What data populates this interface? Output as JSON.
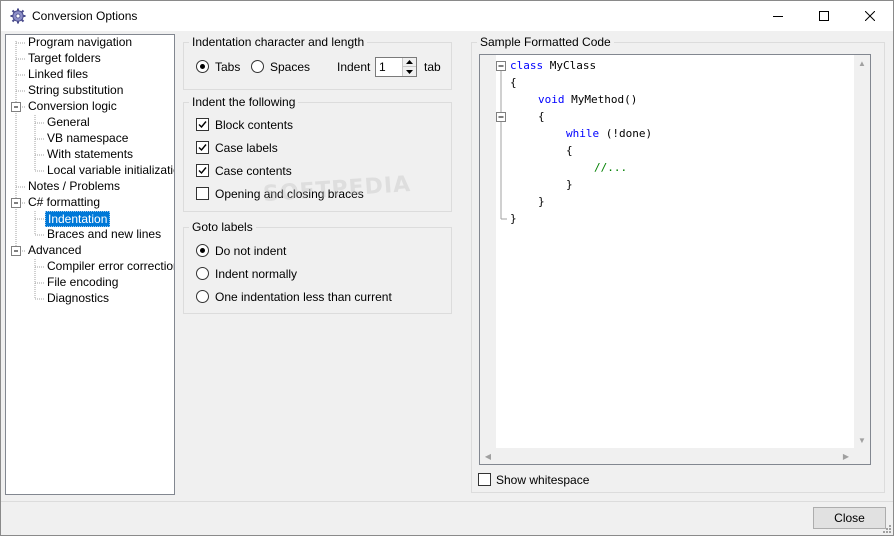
{
  "window": {
    "title": "Conversion Options",
    "icon": "gear-icon"
  },
  "tree": {
    "items": [
      {
        "label": "Program navigation",
        "level": 0,
        "expander": ""
      },
      {
        "label": "Target folders",
        "level": 0,
        "expander": ""
      },
      {
        "label": "Linked files",
        "level": 0,
        "expander": ""
      },
      {
        "label": "String substitution",
        "level": 0,
        "expander": ""
      },
      {
        "label": "Conversion logic",
        "level": 0,
        "expander": "minus"
      },
      {
        "label": "General",
        "level": 1,
        "expander": ""
      },
      {
        "label": "VB namespace",
        "level": 1,
        "expander": ""
      },
      {
        "label": "With statements",
        "level": 1,
        "expander": ""
      },
      {
        "label": "Local variable initialization",
        "level": 1,
        "expander": ""
      },
      {
        "label": "Notes / Problems",
        "level": 0,
        "expander": ""
      },
      {
        "label": "C# formatting",
        "level": 0,
        "expander": "minus"
      },
      {
        "label": "Indentation",
        "level": 1,
        "expander": "",
        "selected": true
      },
      {
        "label": "Braces and new lines",
        "level": 1,
        "expander": ""
      },
      {
        "label": "Advanced",
        "level": 0,
        "expander": "minus"
      },
      {
        "label": "Compiler error correction",
        "level": 1,
        "expander": ""
      },
      {
        "label": "File encoding",
        "level": 1,
        "expander": ""
      },
      {
        "label": "Diagnostics",
        "level": 1,
        "expander": ""
      }
    ]
  },
  "indentation_group": {
    "title": "Indentation character and length",
    "tabs_label": "Tabs",
    "spaces_label": "Spaces",
    "selected": "Tabs",
    "indent_label": "Indent",
    "indent_value": "1",
    "unit_label": "tab"
  },
  "indent_following_group": {
    "title": "Indent the following",
    "options": [
      {
        "label": "Block contents",
        "checked": true
      },
      {
        "label": "Case labels",
        "checked": true
      },
      {
        "label": "Case contents",
        "checked": true
      },
      {
        "label": "Opening and closing braces",
        "checked": false
      }
    ]
  },
  "goto_group": {
    "title": "Goto labels",
    "options": [
      {
        "label": "Do not indent",
        "selected": true
      },
      {
        "label": "Indent normally",
        "selected": false
      },
      {
        "label": "One indentation less than current",
        "selected": false
      }
    ]
  },
  "sample": {
    "title": "Sample Formatted Code",
    "lines": [
      {
        "tokens": [
          {
            "t": "class ",
            "k": "kw"
          },
          {
            "t": "MyClass",
            "k": ""
          }
        ],
        "indent": 0
      },
      {
        "tokens": [
          {
            "t": "{",
            "k": ""
          }
        ],
        "indent": 0
      },
      {
        "tokens": [
          {
            "t": "void ",
            "k": "kw"
          },
          {
            "t": "MyMethod()",
            "k": ""
          }
        ],
        "indent": 1
      },
      {
        "tokens": [
          {
            "t": "{",
            "k": ""
          }
        ],
        "indent": 1
      },
      {
        "tokens": [
          {
            "t": "while ",
            "k": "kw"
          },
          {
            "t": "(!done)",
            "k": ""
          }
        ],
        "indent": 2
      },
      {
        "tokens": [
          {
            "t": "{",
            "k": ""
          }
        ],
        "indent": 2
      },
      {
        "tokens": [
          {
            "t": "//...",
            "k": "cm"
          }
        ],
        "indent": 3
      },
      {
        "tokens": [
          {
            "t": "}",
            "k": ""
          }
        ],
        "indent": 2
      },
      {
        "tokens": [
          {
            "t": "}",
            "k": ""
          }
        ],
        "indent": 1
      },
      {
        "tokens": [
          {
            "t": "}",
            "k": ""
          }
        ],
        "indent": 0
      }
    ],
    "show_whitespace_label": "Show whitespace",
    "show_whitespace": false
  },
  "watermark": "SOFTPEDIA",
  "footer": {
    "close_label": "Close"
  },
  "colors": {
    "selection": "#0078d7",
    "keyword": "#0000ff",
    "comment": "#008000"
  }
}
